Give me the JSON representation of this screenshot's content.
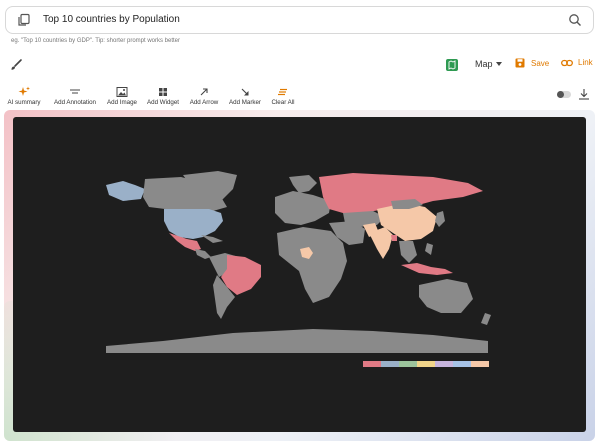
{
  "search": {
    "query": "Top 10 countries by Population",
    "hint": "eg. \"Top 10 countries by GDP\". Tip: shorter prompt works better"
  },
  "controls": {
    "chart_type": "Map",
    "save_label": "Save",
    "link_label": "Link",
    "accent_color": "#e07a00"
  },
  "toolbar": {
    "items": [
      {
        "label": "AI summary",
        "icon": "sparkle-icon"
      },
      {
        "label": "Add Annotation",
        "icon": "text-lines-icon"
      },
      {
        "label": "Add Image",
        "icon": "image-icon"
      },
      {
        "label": "Add Widget",
        "icon": "widget-grid-icon"
      },
      {
        "label": "Add Arrow",
        "icon": "arrow-icon"
      },
      {
        "label": "Add Marker",
        "icon": "marker-icon"
      },
      {
        "label": "Clear All",
        "icon": "eraser-icon"
      }
    ]
  },
  "map": {
    "background": "#1e1e1e",
    "default_country_color": "#8a8a8a",
    "highlight_colors": [
      "#e07a85",
      "#9ab0c8",
      "#9cc49c",
      "#f0d48a",
      "#c7b4dd",
      "#a6c2e6",
      "#f5c8a8"
    ],
    "legend_swatches": [
      "#e07a85",
      "#9ab0c8",
      "#9cc49c",
      "#f0d48a",
      "#c7b4dd",
      "#a6c2e6",
      "#f5c8a8"
    ]
  }
}
